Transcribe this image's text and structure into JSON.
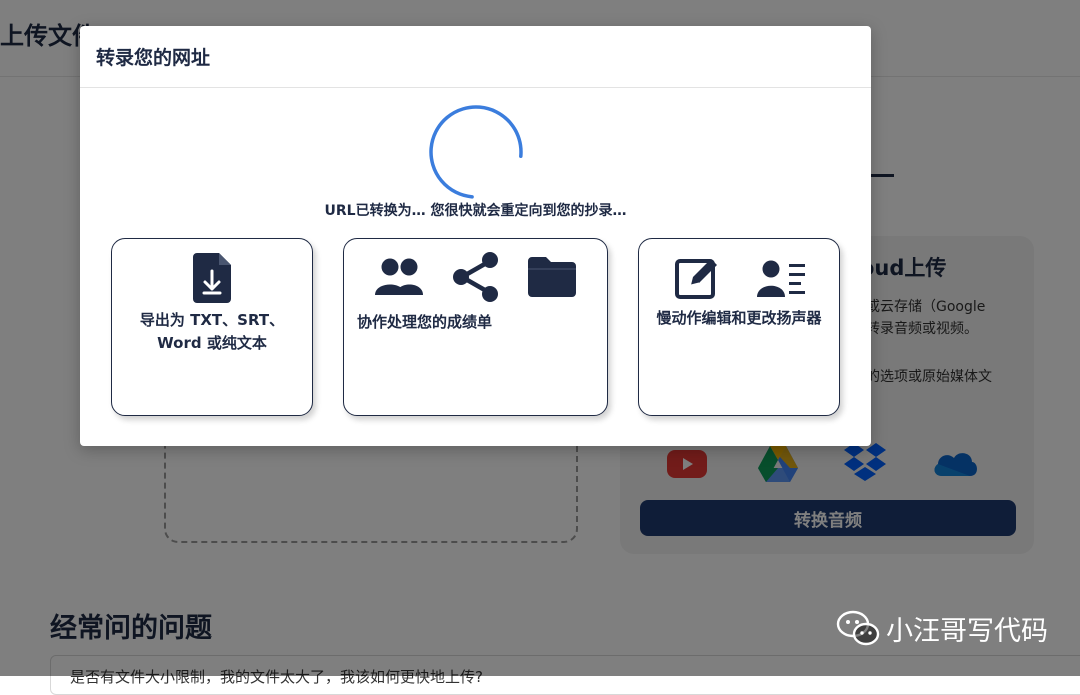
{
  "background": {
    "header_title": "上传文件",
    "cloud_card": {
      "title": "oud上传",
      "description": "或云存储（Google\n转录音频或视频。",
      "description2": "的选项或原始媒体文",
      "icons": [
        "youtube-icon",
        "google-drive-icon",
        "dropbox-icon",
        "onedrive-icon"
      ],
      "convert_button": "转换音频"
    },
    "faq": {
      "title": "经常问的问题",
      "first_question": "是否有文件大小限制，我的文件太大了，我该如何更快地上传?"
    },
    "watermark": "小汪哥写代码"
  },
  "modal": {
    "title": "转录您的网址",
    "status": "URL已转换为… 您很快就会重定向到您的抄录…",
    "cards": [
      {
        "label": "导出为 TXT、SRT、Word 或纯文本",
        "icons": [
          "file-download-icon"
        ]
      },
      {
        "label": "协作处理您的成绩单",
        "icons": [
          "users-icon",
          "share-icon",
          "folder-icon"
        ]
      },
      {
        "label": "慢动作编辑和更改扬声器",
        "icons": [
          "edit-icon",
          "speaker-list-icon"
        ]
      }
    ]
  },
  "colors": {
    "navy": "#1f2a44",
    "button": "#1f3b70",
    "spinner": "#3b7ddd"
  }
}
